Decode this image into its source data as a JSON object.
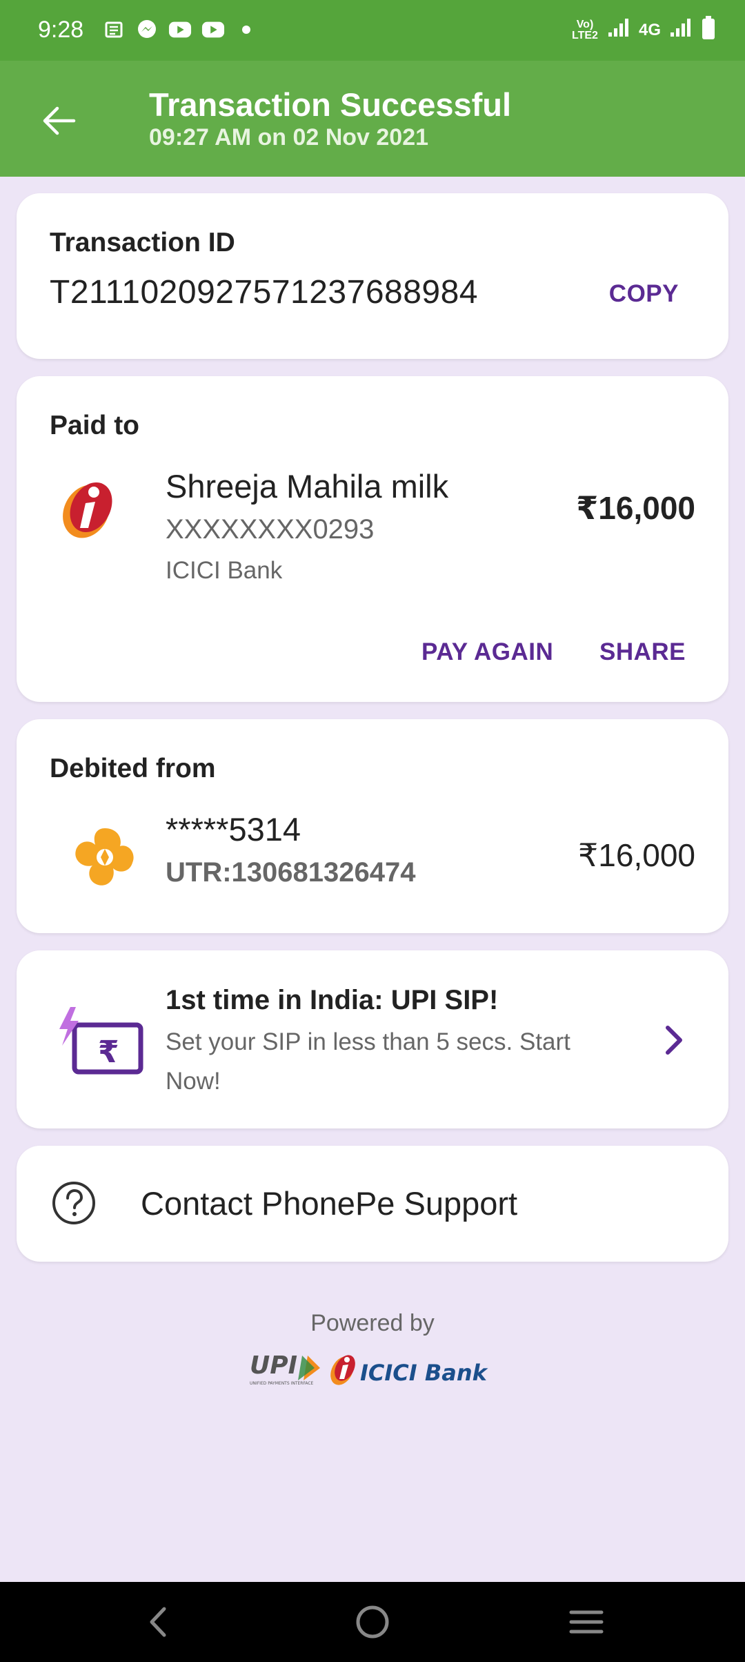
{
  "status_bar": {
    "time": "9:28",
    "network_label": "4G",
    "volte_label": "Vo) LTE2",
    "notif_icons": [
      "news-icon",
      "messenger-icon",
      "youtube-icon",
      "youtube-icon",
      "dot-icon"
    ]
  },
  "header": {
    "title": "Transaction Successful",
    "subtitle": "09:27 AM on 02 Nov 2021",
    "color": "#63ad49"
  },
  "transaction": {
    "label": "Transaction ID",
    "id": "T2111020927571237688984",
    "copy_label": "COPY"
  },
  "paid_to": {
    "label": "Paid to",
    "name": "Shreeja Mahila milk",
    "account": "XXXXXXXX0293",
    "bank": "ICICI Bank",
    "amount": "₹16,000",
    "pay_again_label": "PAY AGAIN",
    "share_label": "SHARE"
  },
  "debited_from": {
    "label": "Debited from",
    "account": "*****5314",
    "utr": "UTR:130681326474",
    "amount": "₹16,000"
  },
  "promo": {
    "title": "1st time in India: UPI SIP!",
    "description": "Set your SIP in less than 5 secs. Start Now!"
  },
  "support": {
    "label": "Contact PhonePe Support"
  },
  "footer": {
    "powered_by": "Powered by",
    "upi_text": "UPI",
    "upi_sub": "UNIFIED PAYMENTS INTERFACE",
    "bank_text": "ICICI Bank"
  },
  "colors": {
    "accent": "#5b2a93",
    "background": "#ede5f6",
    "statusbar": "#55a53b"
  }
}
